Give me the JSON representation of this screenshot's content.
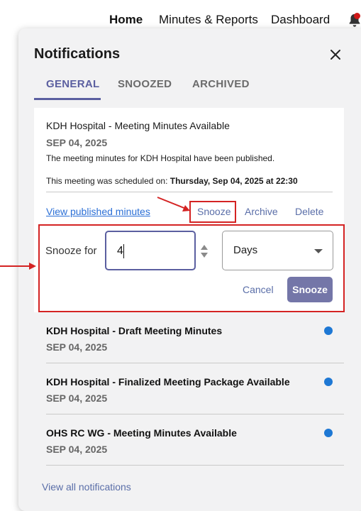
{
  "nav": {
    "home": "Home",
    "minutes_reports": "Minutes & Reports",
    "dashboard": "Dashboard"
  },
  "panel": {
    "title": "Notifications",
    "tabs": [
      "GENERAL",
      "SNOOZED",
      "ARCHIVED"
    ],
    "active_tab": "GENERAL"
  },
  "expanded": {
    "title": "KDH Hospital - Meeting Minutes Available",
    "date": "SEP 04, 2025",
    "body": "The meeting minutes for KDH Hospital have been published.",
    "scheduled_prefix": "This meeting was scheduled on: ",
    "scheduled_value": "Thursday, Sep 04, 2025 at 22:30",
    "actions": {
      "view": "View published minutes",
      "snooze": "Snooze",
      "archive": "Archive",
      "delete": "Delete"
    },
    "snooze_form": {
      "label": "Snooze for",
      "amount": "4",
      "unit": "Days",
      "cancel": "Cancel",
      "submit": "Snooze"
    }
  },
  "items": [
    {
      "title": "KDH Hospital - Draft Meeting Minutes",
      "date": "SEP 04, 2025",
      "unread": true
    },
    {
      "title": "KDH Hospital - Finalized Meeting Package Available",
      "date": "SEP 04, 2025",
      "unread": true
    },
    {
      "title": "OHS RC WG - Meeting Minutes Available",
      "date": "SEP 04, 2025",
      "unread": true
    }
  ],
  "footer": {
    "view_all": "View all notifications"
  },
  "colors": {
    "accent": "#5b5fa0",
    "annotation_red": "#d42323",
    "unread_dot": "#1e78d4",
    "link": "#2b6fd6"
  }
}
